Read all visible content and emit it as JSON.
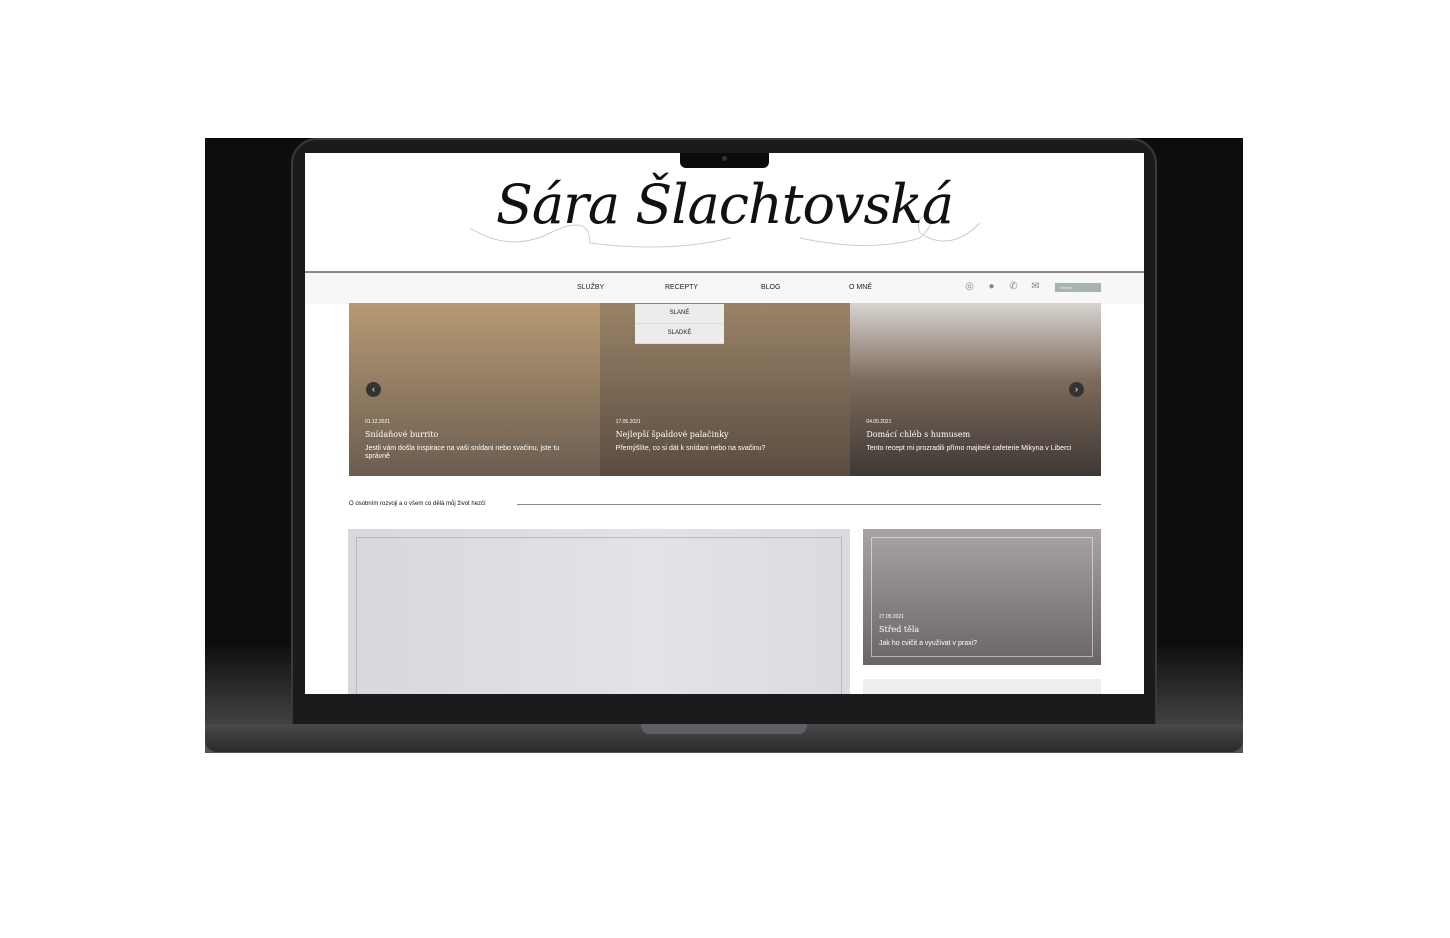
{
  "site": {
    "title": "Sára Šlachtovská"
  },
  "nav": {
    "items": [
      "SLUŽBY",
      "RECEPTY",
      "BLOG",
      "O MNĚ"
    ],
    "search_placeholder": "Hledat...",
    "icons": [
      "instagram-icon",
      "facebook-icon",
      "phone-icon",
      "mail-icon"
    ]
  },
  "dropdown": {
    "items": [
      "SLANÉ",
      "SLADKÉ"
    ]
  },
  "slides": [
    {
      "date": "01.12.2021",
      "title": "Snídaňové burrito",
      "desc": "Jestli vám došla inspirace na vaši snídani nebo svačinu, jste tu správně"
    },
    {
      "date": "17.05.2021",
      "title": "Nejlepší špaldové palačinky",
      "desc": "Přemýšlíte, co si dát k snídani nebo na svačinu?"
    },
    {
      "date": "04.05.2021",
      "title": "Domácí chléb s humusem",
      "desc": "Tento recept mi prozradili přímo majitelé cafeterie Mikyna v Liberci"
    }
  ],
  "section": {
    "tagline": "O osobním rozvoji a o všem co dělá můj život hezčí"
  },
  "cards": [
    {
      "date": "27.05.2021",
      "title": "Střed těla",
      "desc": "Jak ho cvičit a využívat v praxi?"
    }
  ]
}
